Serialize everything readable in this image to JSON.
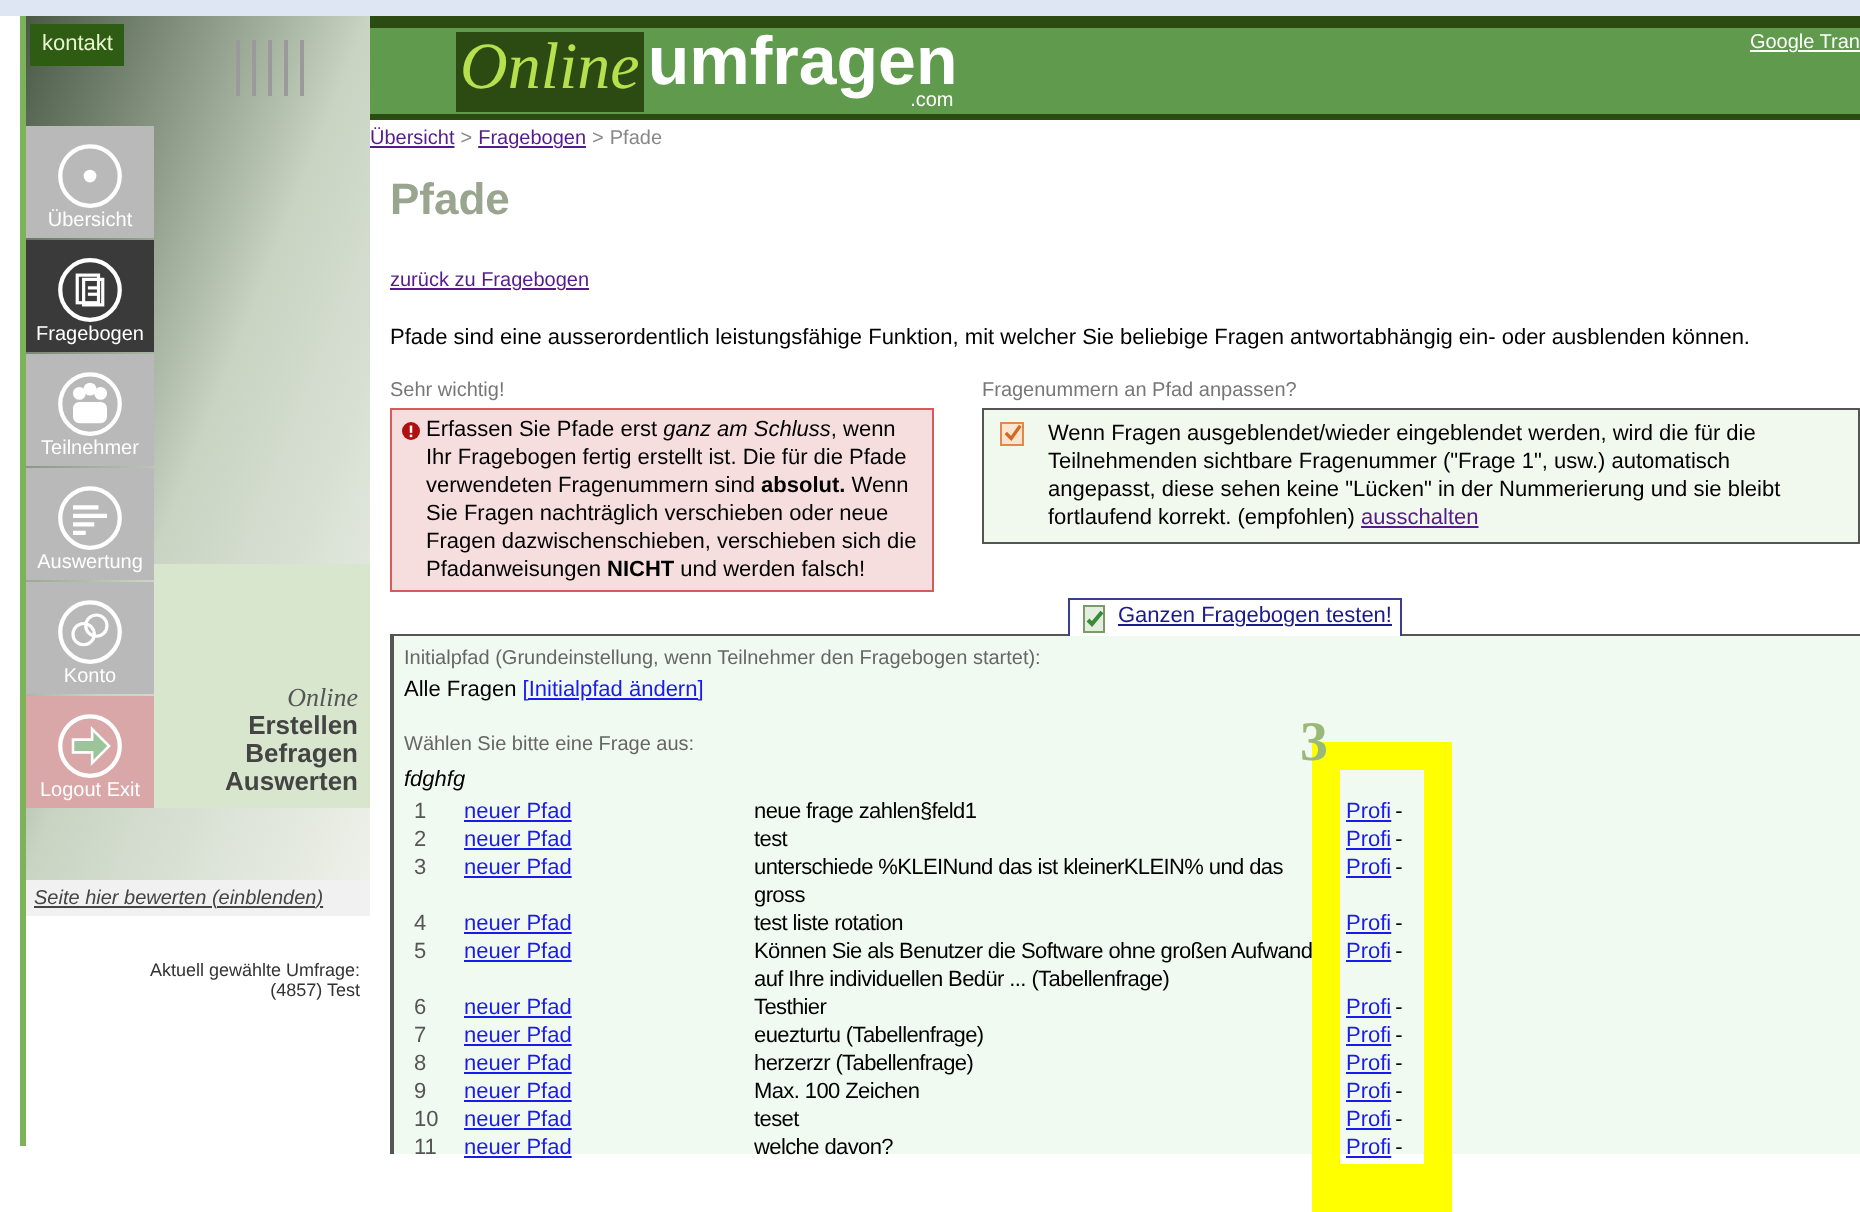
{
  "header": {
    "logo_online": "Online",
    "logo_umfragen": "umfragen",
    "logo_suffix": ".com",
    "translate_link": "Google Tran"
  },
  "sidebar": {
    "contact": "kontakt",
    "nav": [
      {
        "label": "Übersicht",
        "kind": "overview",
        "selected": false
      },
      {
        "label": "Fragebogen",
        "kind": "questionnaire",
        "selected": true
      },
      {
        "label": "Teilnehmer",
        "kind": "participants",
        "selected": false
      },
      {
        "label": "Auswertung",
        "kind": "analysis",
        "selected": false
      },
      {
        "label": "Konto",
        "kind": "account",
        "selected": false
      },
      {
        "label": "Logout Exit",
        "kind": "logout",
        "selected": false
      }
    ],
    "tagline": [
      "Online",
      "Erstellen",
      "Befragen",
      "Auswerten"
    ],
    "rate_link": "Seite hier bewerten (einblenden)",
    "current_survey": {
      "label": "Aktuell gewählte Umfrage:",
      "value": "(4857) Test"
    }
  },
  "breadcrumb": {
    "separator": ">",
    "items": [
      {
        "label": "Übersicht",
        "link": true
      },
      {
        "label": "Fragebogen",
        "link": true
      },
      {
        "label": "Pfade",
        "link": false
      }
    ]
  },
  "title": "Pfade",
  "back_link": "zurück zu Fragebogen",
  "intro": "Pfade sind eine ausserordentlich leistungsfähige Funktion, mit welcher Sie beliebige Fragen antwortabhängig ein- oder ausblenden können.",
  "warning": {
    "heading": "Sehr wichtig!",
    "text": "Erfassen Sie Pfade erst *ganz am Schluss*, wenn Ihr Fragebogen fertig erstellt ist. Die für die Pfade verwendeten Fragenummern sind **absolut.** Wenn Sie Fragen nachträglich verschieben oder neue Fragen dazwischenschieben, verschieben sich die Pfadanweisungen **NICHT** und werden falsch!"
  },
  "numbering": {
    "heading": "Fragenummern an Pfad anpassen?",
    "checked": true,
    "text": "Wenn Fragen ausgeblendet/wieder eingeblendet werden, wird die für die Teilnehmenden sichtbare Fragenummer (\"Frage 1\", usw.) automatisch angepasst, diese sehen keine \"Lücken\" in der Nummerierung und sie bleibt fortlaufend korrekt. (empfohlen)",
    "link": "ausschalten"
  },
  "test_button": "Ganzen Fragebogen testen!",
  "initial_path": {
    "label": "Initialpfad (Grundeinstellung, wenn Teilnehmer den Fragebogen startet):",
    "value": "Alle Fragen",
    "link": "[Initialpfad ändern]"
  },
  "choose_label": "Wählen Sie bitte eine Frage aus:",
  "group": "fdghfg",
  "rows": [
    {
      "number": "1",
      "path_link": "neuer Pfad",
      "question": "neue frage zahlen§feld1",
      "profi": "Profi",
      "dash": "-"
    },
    {
      "number": "2",
      "path_link": "neuer Pfad",
      "question": "test",
      "profi": "Profi",
      "dash": "-"
    },
    {
      "number": "3",
      "path_link": "neuer Pfad",
      "question": "unterschiede %KLEINund das ist kleinerKLEIN% und das gross",
      "profi": "Profi",
      "dash": "-"
    },
    {
      "number": "4",
      "path_link": "neuer Pfad",
      "question": "test liste rotation",
      "profi": "Profi",
      "dash": "-"
    },
    {
      "number": "5",
      "path_link": "neuer Pfad",
      "question": "Können Sie als Benutzer die Software ohne großen Aufwand auf Ihre individuellen Bedür ... (Tabellenfrage)",
      "profi": "Profi",
      "dash": "-"
    },
    {
      "number": "6",
      "path_link": "neuer Pfad",
      "question": "Testhier",
      "profi": "Profi",
      "dash": "-"
    },
    {
      "number": "7",
      "path_link": "neuer Pfad",
      "question": "euezturtu (Tabellenfrage)",
      "profi": "Profi",
      "dash": "-"
    },
    {
      "number": "8",
      "path_link": "neuer Pfad",
      "question": "herzerzr (Tabellenfrage)",
      "profi": "Profi",
      "dash": "-"
    },
    {
      "number": "9",
      "path_link": "neuer Pfad",
      "question": "Max. 100 Zeichen",
      "profi": "Profi",
      "dash": "-"
    },
    {
      "number": "10",
      "path_link": "neuer Pfad",
      "question": "teset",
      "profi": "Profi",
      "dash": "-"
    },
    {
      "number": "11",
      "path_link": "neuer Pfad",
      "question": "welche davon?",
      "profi": "Profi",
      "dash": "-"
    }
  ],
  "annotation": {
    "label": "3"
  }
}
